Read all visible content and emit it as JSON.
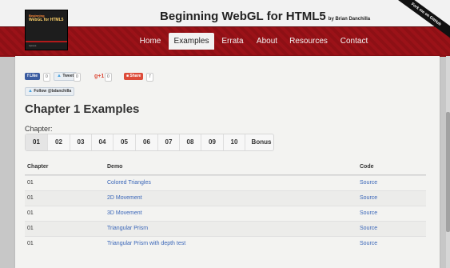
{
  "header": {
    "site_title": "Beginning WebGL for HTML5",
    "byline": "by Brian Danchilla",
    "book_cover": {
      "line1": "Beginning",
      "line2": "WebGL for HTML5",
      "publisher": "Apress"
    },
    "ribbon": "Fork me on GitHub"
  },
  "nav": {
    "items": [
      {
        "label": "Home"
      },
      {
        "label": "Examples"
      },
      {
        "label": "Errata"
      },
      {
        "label": "About"
      },
      {
        "label": "Resources"
      },
      {
        "label": "Contact"
      }
    ],
    "active": "Examples"
  },
  "social": {
    "like_label": "Like",
    "like_count": "0",
    "tweet_label": "Tweet",
    "tweet_count": "0",
    "gplus_label": "g+1",
    "gplus_count": "0",
    "share_label": "Share",
    "share_count": "7",
    "follow_label": "Follow @bdanchilla"
  },
  "main": {
    "title": "Chapter 1 Examples",
    "chapter_label": "Chapter:",
    "pages": [
      "01",
      "02",
      "03",
      "04",
      "05",
      "06",
      "07",
      "08",
      "09",
      "10",
      "Bonus"
    ],
    "active_page": "01"
  },
  "table": {
    "headers": [
      "Chapter",
      "Demo",
      "Code"
    ],
    "rows": [
      {
        "chapter": "01",
        "demo": "Colored Triangles",
        "code": "Source"
      },
      {
        "chapter": "01",
        "demo": "2D Movement",
        "code": "Source"
      },
      {
        "chapter": "01",
        "demo": "3D Movement",
        "code": "Source"
      },
      {
        "chapter": "01",
        "demo": "Triangular Prism",
        "code": "Source"
      },
      {
        "chapter": "01",
        "demo": "Triangular Prism with depth test",
        "code": "Source"
      }
    ]
  },
  "colors": {
    "nav_red": "#9b1218",
    "link_blue": "#3a66b8",
    "facebook_blue": "#3b5ca0",
    "share_red": "#dd4b39"
  }
}
